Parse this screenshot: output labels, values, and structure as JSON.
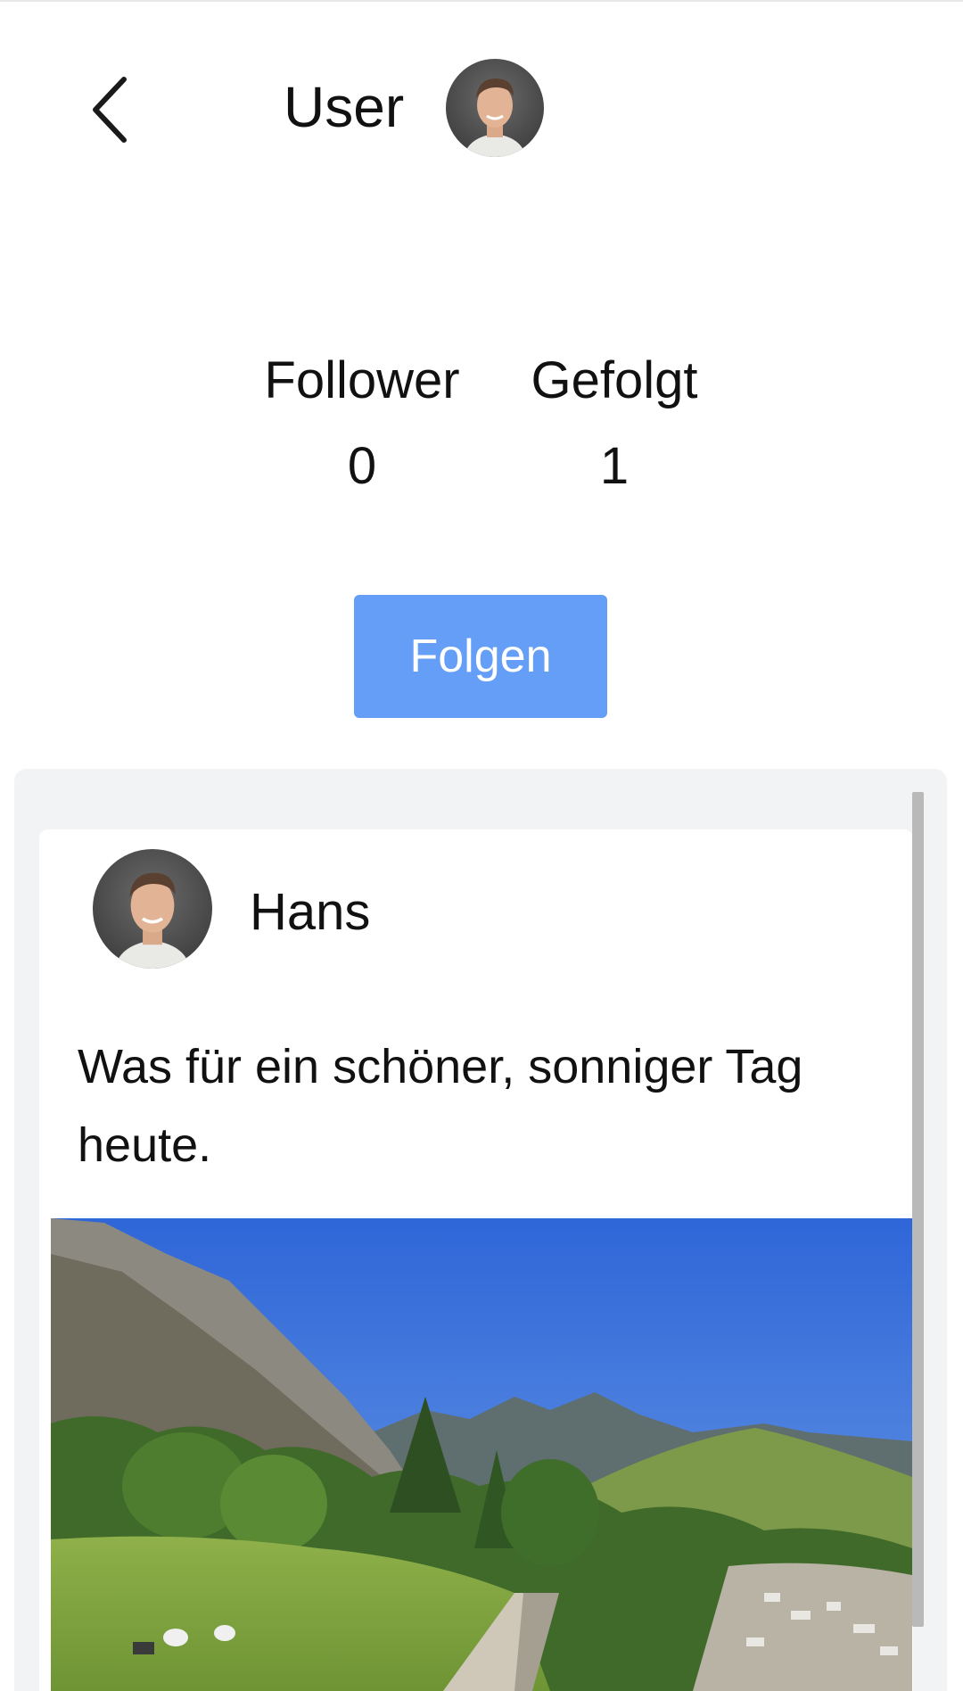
{
  "header": {
    "back_icon": "chevron-left-icon",
    "title": "User",
    "avatar_icon": "user-avatar"
  },
  "stats": {
    "followers_label": "Follower",
    "followers_count": "0",
    "following_label": "Gefolgt",
    "following_count": "1"
  },
  "actions": {
    "follow_label": "Folgen"
  },
  "feed": {
    "posts": [
      {
        "author": "Hans",
        "text": "Was für ein schöner, sonniger Tag heute.",
        "image": "mountain-landscape-photo"
      }
    ]
  },
  "colors": {
    "accent": "#649ef6",
    "feed_background": "#f2f3f5",
    "card_background": "#ffffff",
    "text": "#111111"
  }
}
